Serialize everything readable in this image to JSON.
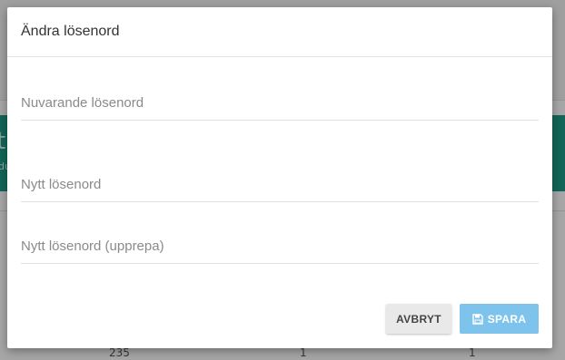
{
  "modal": {
    "title": "Ändra lösenord",
    "fields": [
      {
        "placeholder": "Nuvarande lösenord",
        "value": ""
      },
      {
        "placeholder": "Nytt lösenord",
        "value": ""
      },
      {
        "placeholder": "Nytt lösenord (upprepa)",
        "value": ""
      }
    ],
    "buttons": {
      "cancel_label": "AVBRYT",
      "save_label": "SPARA"
    }
  },
  "background": {
    "banner_text_big": "t",
    "banner_text_small": "du",
    "table_row": [
      "235",
      "1",
      "1"
    ]
  },
  "colors": {
    "banner": "#1c9b87",
    "save_button": "#7dc3ec",
    "cancel_button": "#e9e9e9"
  },
  "icons": {
    "save": "floppy-disk-icon"
  }
}
